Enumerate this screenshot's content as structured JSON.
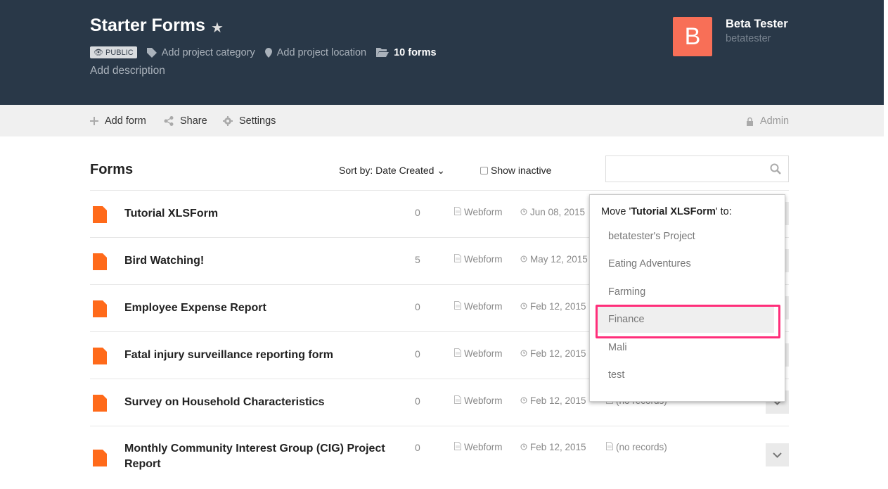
{
  "project": {
    "title": "Starter Forms",
    "visibility": "PUBLIC",
    "category_link": "Add project category",
    "location_link": "Add project location",
    "forms_count": "10 forms",
    "description_link": "Add description"
  },
  "user": {
    "initial": "B",
    "name": "Beta Tester",
    "handle": "betatester",
    "avatar_color": "#f86f57"
  },
  "toolbar": {
    "add_form": "Add form",
    "share": "Share",
    "settings": "Settings",
    "admin": "Admin"
  },
  "forms": {
    "heading": "Forms",
    "sort_label": "Sort by: Date Created",
    "show_inactive": "Show inactive",
    "search_placeholder": "",
    "rows": [
      {
        "name": "Tutorial XLSForm",
        "count": "0",
        "type": "Webform",
        "date": "Jun 08, 2015",
        "status": ""
      },
      {
        "name": "Bird Watching!",
        "count": "5",
        "type": "Webform",
        "date": "May 12, 2015",
        "status": ""
      },
      {
        "name": "Employee Expense Report",
        "count": "0",
        "type": "Webform",
        "date": "Feb 12, 2015",
        "status": ""
      },
      {
        "name": "Fatal injury surveillance reporting form",
        "count": "0",
        "type": "Webform",
        "date": "Feb 12, 2015",
        "status": ""
      },
      {
        "name": "Survey on Household Characteristics",
        "count": "0",
        "type": "Webform",
        "date": "Feb 12, 2015",
        "status": "(no records)"
      },
      {
        "name": "Monthly Community Interest Group (CIG) Project Report",
        "count": "0",
        "type": "Webform",
        "date": "Feb 12, 2015",
        "status": "(no records)"
      }
    ]
  },
  "move_menu": {
    "prefix": "Move '",
    "form": "Tutorial XLSForm",
    "suffix": "' to:",
    "highlighted": "Finance",
    "highlight_color": "#ff2e7a",
    "items": [
      "betatester's Project",
      "Eating Adventures",
      "Farming",
      "Finance",
      "Mali",
      "test"
    ]
  },
  "colors": {
    "header": "#293848",
    "accent": "#ff6a1a"
  }
}
